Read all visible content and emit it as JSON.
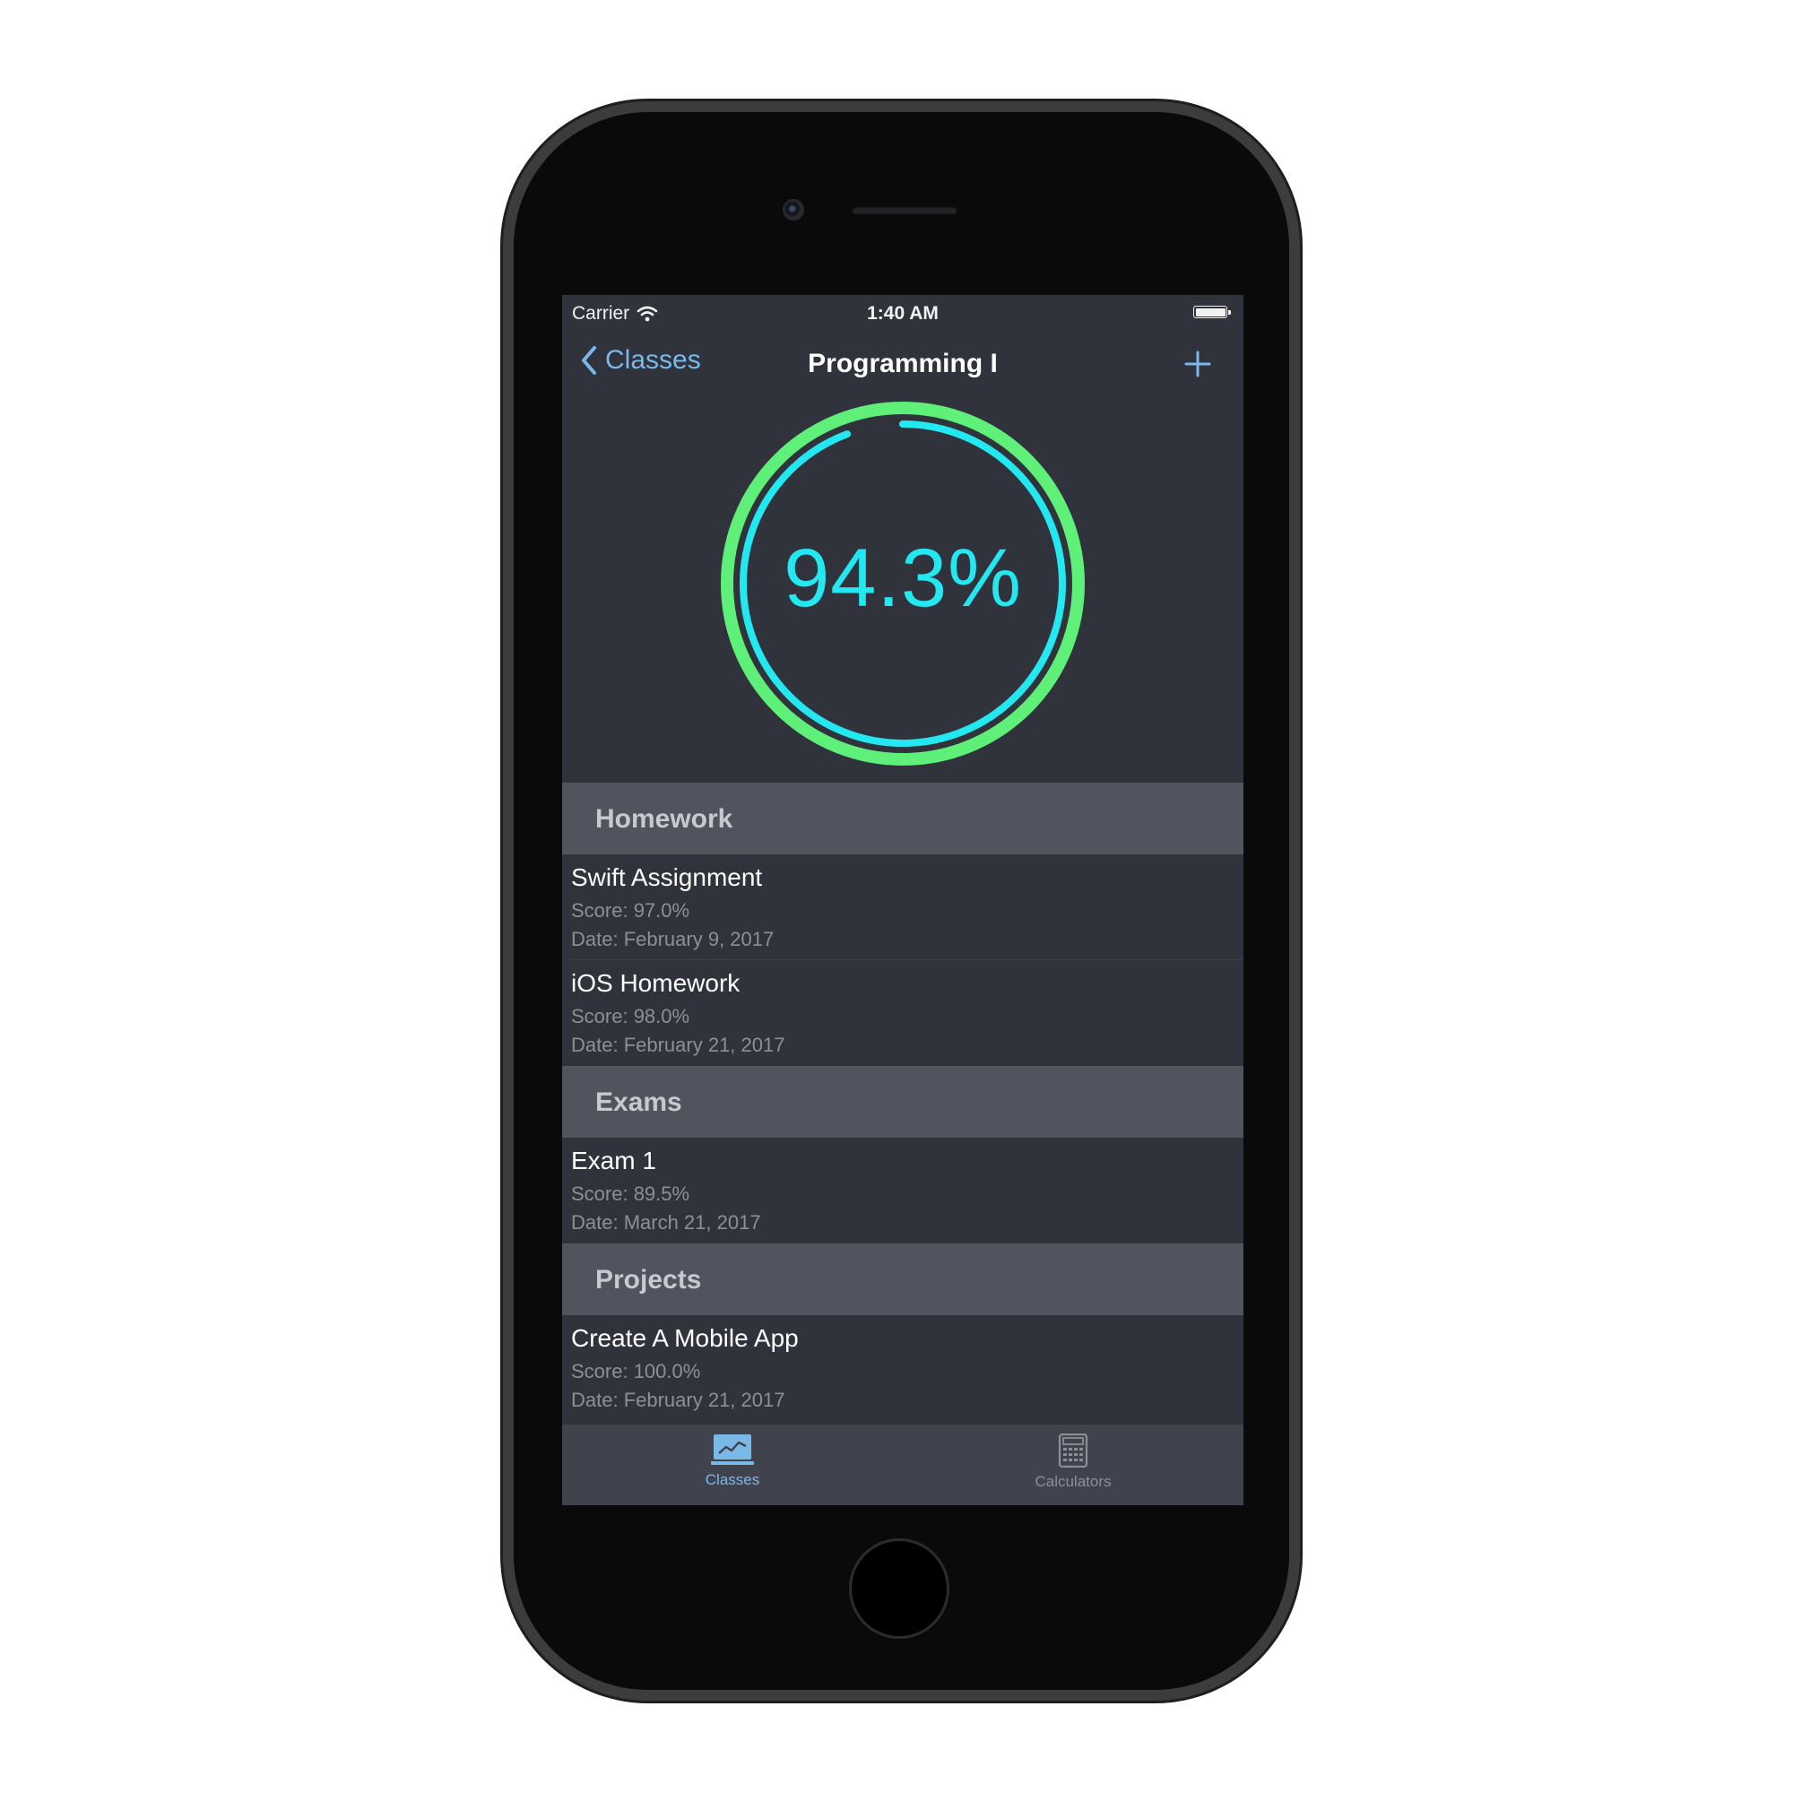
{
  "status_bar": {
    "carrier": "Carrier",
    "time": "1:40 AM"
  },
  "nav": {
    "back_label": "Classes",
    "title": "Programming I",
    "add_icon": "plus-icon"
  },
  "grade": {
    "text": "94.3%",
    "progress": 0.943
  },
  "colors": {
    "ring_outer": "#5ff07a",
    "ring_inner": "#23e8f0",
    "accent": "#7ab8e8"
  },
  "sections": [
    {
      "header": "Homework",
      "items": [
        {
          "title": "Swift Assignment",
          "score": "Score: 97.0%",
          "date": "Date: February 9, 2017"
        },
        {
          "title": "iOS Homework",
          "score": "Score: 98.0%",
          "date": "Date: February 21, 2017"
        }
      ]
    },
    {
      "header": "Exams",
      "items": [
        {
          "title": "Exam 1",
          "score": "Score: 89.5%",
          "date": "Date: March 21, 2017"
        }
      ]
    },
    {
      "header": "Projects",
      "items": [
        {
          "title": "Create A Mobile App",
          "score": "Score: 100.0%",
          "date": "Date: February 21, 2017"
        }
      ]
    }
  ],
  "tabs": [
    {
      "label": "Classes",
      "icon": "chart-icon",
      "selected": true
    },
    {
      "label": "Calculators",
      "icon": "calculator-icon",
      "selected": false
    }
  ]
}
